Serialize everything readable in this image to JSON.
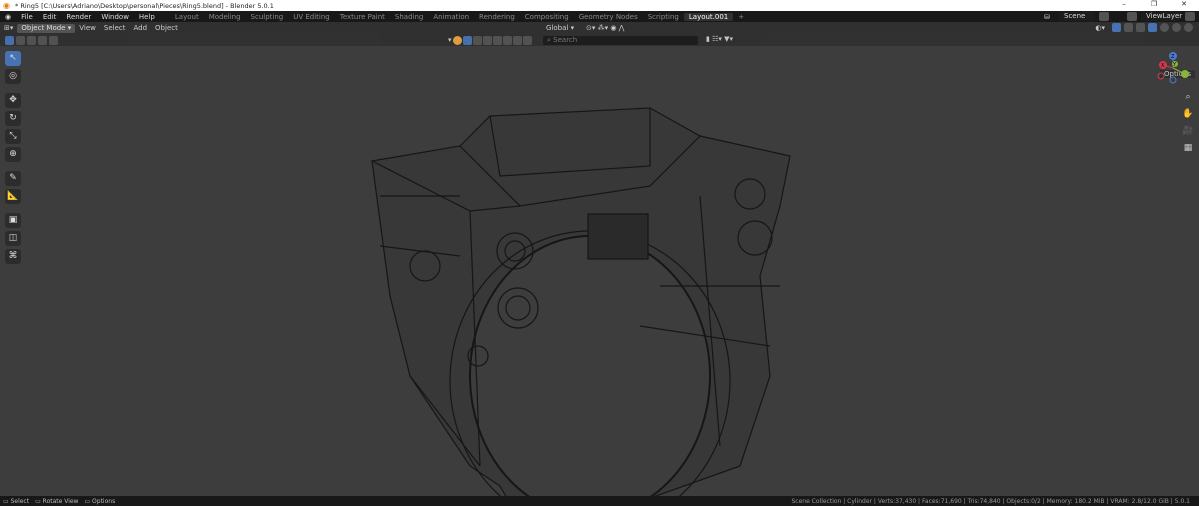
{
  "window": {
    "title": "* Ring5 [C:\\Users\\Adriano\\Desktop\\personal\\Pieces\\Ring5.blend] - Blender 5.0.1",
    "controls": [
      "–",
      "❐",
      "✕"
    ]
  },
  "menu": {
    "items": [
      "File",
      "Edit",
      "Render",
      "Window",
      "Help"
    ],
    "workspaces": [
      "Layout",
      "Modeling",
      "Sculpting",
      "UV Editing",
      "Texture Paint",
      "Shading",
      "Animation",
      "Rendering",
      "Compositing",
      "Geometry Nodes",
      "Scripting",
      "Layout.001"
    ],
    "active_workspace": "Layout.001",
    "add_tab": "+",
    "scene": "Scene",
    "view_layer": "ViewLayer"
  },
  "header": {
    "mode": "Object Mode",
    "menus": [
      "View",
      "Select",
      "Add",
      "Object"
    ],
    "orientation": "Global"
  },
  "search": {
    "placeholder": "Search"
  },
  "options_label": "Options",
  "gizmo": {
    "x": "X",
    "y": "Y",
    "z": "Z"
  },
  "status": {
    "left": [
      "Select",
      "Rotate View",
      "Options"
    ],
    "right": "Scene Collection | Cylinder | Verts:37,430 | Faces:71,690 | Tris:74,840 | Objects:0/2 | Memory: 180.2 MiB | VRAM: 2.8/12.0 GiB | 5.0.1"
  },
  "colors": {
    "accent": "#4772b3",
    "viewport": "#3d3d3d",
    "wire": "#111111"
  }
}
